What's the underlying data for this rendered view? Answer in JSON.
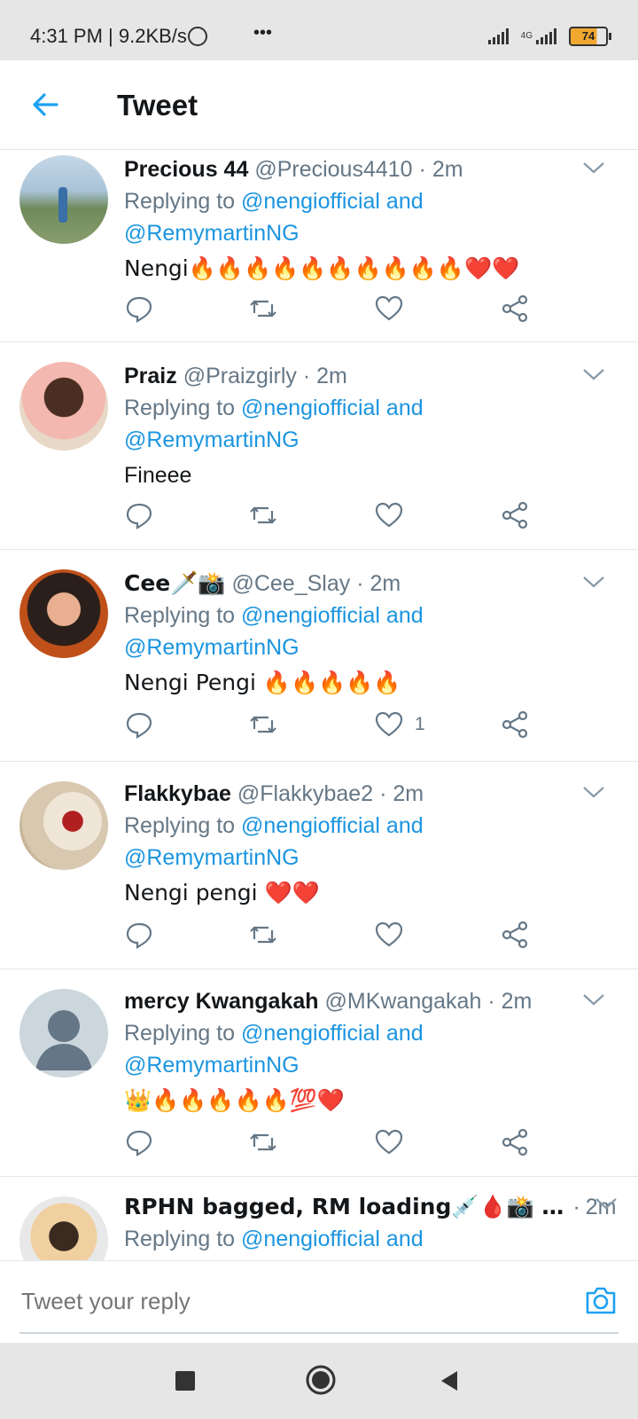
{
  "status_bar": {
    "time": "4:31 PM | 9.2KB/s",
    "network": "4G",
    "battery": "74",
    "more": "•••"
  },
  "header": {
    "title": "Tweet"
  },
  "colors": {
    "link": "#1b95e0",
    "muted": "#657786",
    "text": "#14171a",
    "divider": "#e1e8ed"
  },
  "replying_prefix": "Replying to",
  "tweets": [
    {
      "name": "Precious 44",
      "handle": "@Precious4410",
      "time": "2m",
      "mention1": "@nengiofficial and",
      "mention2": "@RemymartinNG",
      "text": "Nengi🔥🔥🔥🔥🔥🔥🔥🔥🔥🔥❤️❤️",
      "likes": ""
    },
    {
      "name": "Praiz",
      "handle": "@Praizgirly",
      "time": "2m",
      "mention1": "@nengiofficial and",
      "mention2": "@RemymartinNG",
      "text": "Fineee",
      "likes": ""
    },
    {
      "name": "Cee🗡️📸",
      "handle": "@Cee_Slay",
      "time": "2m",
      "mention1": "@nengiofficial and",
      "mention2": "@RemymartinNG",
      "text": "Nengi Pengi 🔥🔥🔥🔥🔥",
      "likes": "1"
    },
    {
      "name": "Flakkybae",
      "handle": "@Flakkybae2",
      "time": "2m",
      "mention1": "@nengiofficial and",
      "mention2": "@RemymartinNG",
      "text": "Nengi pengi ❤️❤️",
      "likes": ""
    },
    {
      "name": "mercy Kwangakah",
      "handle": "@MKwangakah",
      "time": "2m",
      "mention1": "@nengiofficial and",
      "mention2": "@RemymartinNG",
      "text": "👑🔥🔥🔥🔥🔥💯❤️",
      "likes": ""
    },
    {
      "name": "RPHN bagged, RM loading💉🩸📸 …",
      "handle": "",
      "time": "2m",
      "mention1": "@nengiofficial and",
      "mention2": "",
      "text": "",
      "likes": ""
    }
  ],
  "composer": {
    "placeholder": "Tweet your reply"
  },
  "icons": {
    "back": "arrow-left-icon",
    "reply": "reply-icon",
    "retweet": "retweet-icon",
    "like": "heart-icon",
    "share": "share-icon",
    "camera": "camera-icon",
    "caret": "chevron-down-icon"
  }
}
